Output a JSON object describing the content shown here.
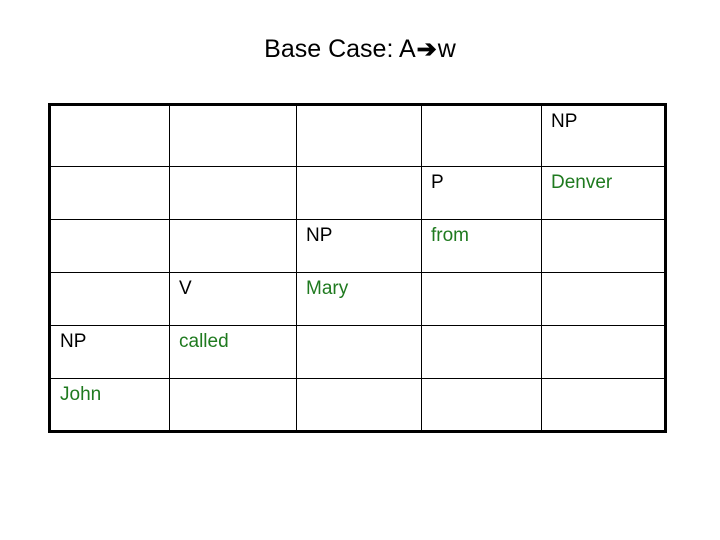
{
  "slide": {
    "title_prefix": "Base Case: A",
    "title_arrow": "➔",
    "title_suffix": "w",
    "title_full": "Base Case: A➔w",
    "background_color": "#ffffff"
  },
  "colors": {
    "terminal_text": "#1f7a1f",
    "nonterminal_text": "#000000",
    "border": "#000000",
    "background": "#ffffff"
  },
  "table": {
    "rows": 6,
    "cols": 5,
    "cells": [
      [
        {
          "text": "",
          "kind": "empty"
        },
        {
          "text": "",
          "kind": "empty"
        },
        {
          "text": "",
          "kind": "empty"
        },
        {
          "text": "",
          "kind": "empty"
        },
        {
          "text": "NP",
          "kind": "nonterminal"
        }
      ],
      [
        {
          "text": "",
          "kind": "empty"
        },
        {
          "text": "",
          "kind": "empty"
        },
        {
          "text": "",
          "kind": "empty"
        },
        {
          "text": "P",
          "kind": "nonterminal"
        },
        {
          "text": "Denver",
          "kind": "terminal"
        }
      ],
      [
        {
          "text": "",
          "kind": "empty"
        },
        {
          "text": "",
          "kind": "empty"
        },
        {
          "text": "NP",
          "kind": "nonterminal"
        },
        {
          "text": "from",
          "kind": "terminal"
        },
        {
          "text": "",
          "kind": "empty"
        }
      ],
      [
        {
          "text": "",
          "kind": "empty"
        },
        {
          "text": "V",
          "kind": "nonterminal"
        },
        {
          "text": "Mary",
          "kind": "terminal"
        },
        {
          "text": "",
          "kind": "empty"
        },
        {
          "text": "",
          "kind": "empty"
        }
      ],
      [
        {
          "text": "NP",
          "kind": "nonterminal"
        },
        {
          "text": "called",
          "kind": "terminal"
        },
        {
          "text": "",
          "kind": "empty"
        },
        {
          "text": "",
          "kind": "empty"
        },
        {
          "text": "",
          "kind": "empty"
        }
      ],
      [
        {
          "text": "John",
          "kind": "terminal"
        },
        {
          "text": "",
          "kind": "empty"
        },
        {
          "text": "",
          "kind": "empty"
        },
        {
          "text": "",
          "kind": "empty"
        },
        {
          "text": "",
          "kind": "empty"
        }
      ]
    ]
  }
}
